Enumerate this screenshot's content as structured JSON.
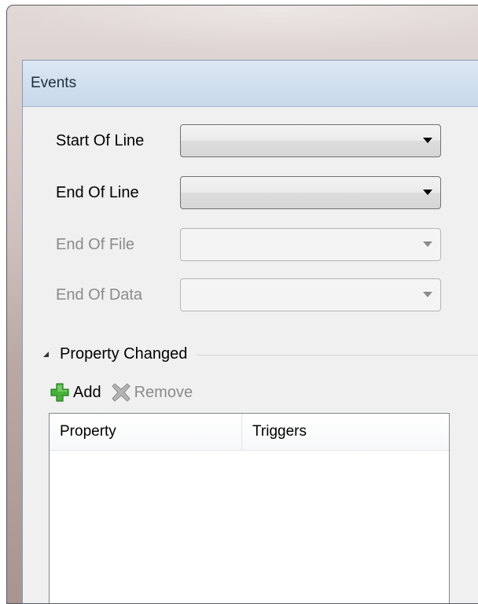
{
  "panel": {
    "title": "Events"
  },
  "fields": [
    {
      "label": "Start Of Line",
      "value": "",
      "enabled": true
    },
    {
      "label": "End Of Line",
      "value": "",
      "enabled": true
    },
    {
      "label": "End Of File",
      "value": "",
      "enabled": false
    },
    {
      "label": "End Of Data",
      "value": "",
      "enabled": false
    }
  ],
  "property_changed": {
    "title": "Property Changed",
    "toolbar": {
      "add_label": "Add",
      "remove_label": "Remove"
    },
    "table": {
      "columns": [
        "Property",
        "Triggers"
      ],
      "rows": []
    }
  },
  "colors": {
    "header_bg": "#c8d9ea",
    "add_icon": "#3fa535",
    "remove_icon": "#9a9a9a",
    "disabled_text": "#8b8b8b"
  },
  "icons": {
    "add": "green-plus-icon",
    "remove": "gray-x-icon",
    "collapse": "collapse-triangle-icon",
    "dropdown": "chevron-down-icon"
  }
}
